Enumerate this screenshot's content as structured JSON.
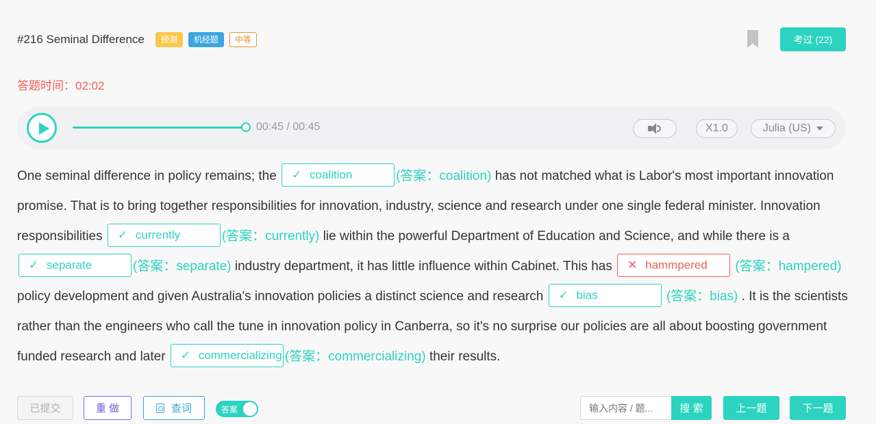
{
  "header": {
    "title": "#216 Seminal Difference",
    "tags": [
      "预测",
      "机经题",
      "中等"
    ],
    "passed_label": "考过 (22)"
  },
  "timer": {
    "label": "答题时间：02:02"
  },
  "player": {
    "progress": 1.0,
    "time": "00:45 / 00:45",
    "speed": "X1.0",
    "voice": "Julia (US)"
  },
  "passage": {
    "t1": "One seminal difference in policy remains; the ",
    "b1": {
      "mark": "✓",
      "value": "coalition"
    },
    "a1": "(答案：coalition)",
    "t2": " has not matched what is Labor's most important innovation promise. That is to bring together responsibilities for innovation, industry, science and research under one single federal minister. Innovation responsibilities ",
    "b2": {
      "mark": "✓",
      "value": "currently"
    },
    "a2": "(答案：currently)",
    "t3": " lie within the powerful Department of Education and Science, and while there is a ",
    "b3": {
      "mark": "✓",
      "value": "separate"
    },
    "a3": "(答案：separate)",
    "t4": " industry department, it has little influence within Cabinet. This has ",
    "b4": {
      "mark": "✕",
      "value": "hammpered"
    },
    "a4": "(答案：hampered)",
    "t5": " policy development and given Australia's innovation policies a distinct science and research ",
    "b5": {
      "mark": "✓",
      "value": "bias"
    },
    "a5": "(答案：bias)",
    "t6": " . It is the scientists rather than the engineers who call the tune in innovation policy in Canberra, so it's no surprise our policies are all about boosting government funded research and later ",
    "b6": {
      "mark": "✓",
      "value": "commercializing"
    },
    "a6": "(答案：commercializing)",
    "t7": " their results."
  },
  "footer": {
    "submitted": "已提交",
    "redo": "重 做",
    "lookup": "查词",
    "answer_toggle": "答案",
    "answer_toggle_on": true,
    "search_placeholder": "输入内容 / 题...",
    "search_button": "搜 索",
    "prev": "上一题",
    "next": "下一题"
  },
  "colors": {
    "accent": "#2cd3c0",
    "error": "#f0605a",
    "tag_predict": "#f9c84a",
    "tag_machine": "#3aa5e0",
    "tag_level": "#e8952a",
    "redo": "#6a62e0"
  },
  "icons": [
    "bookmark-icon",
    "play-icon",
    "volume-icon",
    "caret-down-icon",
    "check-icon",
    "cross-icon",
    "document-icon"
  ]
}
